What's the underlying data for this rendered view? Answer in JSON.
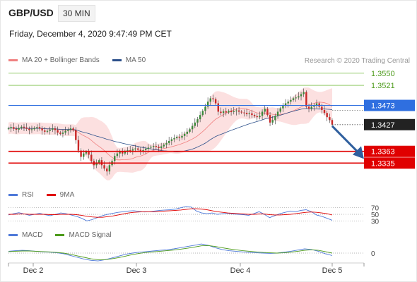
{
  "header": {
    "pair": "GBP/USD",
    "timeframe": "30 MIN",
    "datetime": "Friday, December 4, 2020 9:47:49 PM CET"
  },
  "legends": {
    "main": [
      {
        "label": "MA 20 + Bollinger Bands",
        "color": "#f08080"
      },
      {
        "label": "MA 50",
        "color": "#2b4f8a"
      }
    ],
    "rsi": [
      {
        "label": "RSI",
        "color": "#4e79d9"
      },
      {
        "label": "9MA",
        "color": "#e00000"
      }
    ],
    "macd": [
      {
        "label": "MACD",
        "color": "#4e79d9"
      },
      {
        "label": "MACD Signal",
        "color": "#4c9a1a"
      }
    ]
  },
  "credit": "Research © 2020 Trading Central",
  "chart_data": {
    "type": "candlestick",
    "instrument": "GBP/USD",
    "interval": "30 MIN",
    "x_ticks": [
      "Dec 2",
      "Dec 3",
      "Dec 4",
      "Dec 5"
    ],
    "ylim": [
      1.329,
      1.3565
    ],
    "current_price": 1.3427,
    "levels": [
      {
        "value": 1.355,
        "label": "1.3550",
        "kind": "resistance",
        "color": "#7cbf4a"
      },
      {
        "value": 1.3521,
        "label": "1.3521",
        "kind": "resistance",
        "color": "#7cbf4a"
      },
      {
        "value": 1.3473,
        "label": "1.3473",
        "kind": "pivot",
        "color": "#2f6fe0"
      },
      {
        "value": 1.3427,
        "label": "1.3427",
        "kind": "last",
        "color": "#222222"
      },
      {
        "value": 1.3363,
        "label": "1.3363",
        "kind": "support",
        "color": "#e00000"
      },
      {
        "value": 1.3335,
        "label": "1.3335",
        "kind": "support",
        "color": "#e00000"
      }
    ],
    "forecast_arrow": {
      "from": 1.3427,
      "to": 1.3335,
      "direction": "down"
    },
    "close_path": [
      1.3418,
      1.3421,
      1.3417,
      1.3415,
      1.3419,
      1.3422,
      1.342,
      1.3417,
      1.3414,
      1.3416,
      1.3419,
      1.3421,
      1.3418,
      1.3413,
      1.341,
      1.3412,
      1.3415,
      1.3418,
      1.3414,
      1.3408,
      1.3405,
      1.3408,
      1.3412,
      1.3415,
      1.3418,
      1.3414,
      1.339,
      1.3365,
      1.335,
      1.3358,
      1.3362,
      1.3355,
      1.334,
      1.333,
      1.3335,
      1.3342,
      1.333,
      1.3322,
      1.3315,
      1.333,
      1.334,
      1.3352,
      1.3358,
      1.3362,
      1.3358,
      1.3363,
      1.3366,
      1.3365,
      1.3368,
      1.337,
      1.3367,
      1.3363,
      1.3366,
      1.3369,
      1.3372,
      1.3374,
      1.3376,
      1.3374,
      1.3371,
      1.3375,
      1.3379,
      1.3383,
      1.3388,
      1.3392,
      1.3395,
      1.3398,
      1.3396,
      1.34,
      1.3405,
      1.341,
      1.3416,
      1.3424,
      1.3432,
      1.344,
      1.345,
      1.346,
      1.347,
      1.3482,
      1.349,
      1.3488,
      1.3478,
      1.3458,
      1.3455,
      1.3459,
      1.3456,
      1.346,
      1.3457,
      1.3459,
      1.3461,
      1.3458,
      1.3456,
      1.3455,
      1.3452,
      1.3454,
      1.345,
      1.3447,
      1.3445,
      1.3448,
      1.3458,
      1.3465,
      1.345,
      1.3432,
      1.3438,
      1.3448,
      1.3458,
      1.3466,
      1.3472,
      1.3478,
      1.3482,
      1.3486,
      1.349,
      1.3492,
      1.3495,
      1.35,
      1.3505,
      1.347,
      1.3465,
      1.347,
      1.3473,
      1.3478,
      1.347,
      1.3462,
      1.3455,
      1.3445,
      1.3438,
      1.3427
    ],
    "rsi": {
      "levels": [
        70,
        50,
        30
      ],
      "rsi": [
        48,
        52,
        55,
        51,
        47,
        50,
        53,
        49,
        46,
        50,
        54,
        52,
        48,
        44,
        38,
        30,
        34,
        40,
        46,
        50,
        53,
        56,
        58,
        60,
        61,
        59,
        57,
        58,
        60,
        62,
        63,
        64,
        66,
        70,
        74,
        72,
        60,
        54,
        52,
        54,
        50,
        52,
        53,
        51,
        50,
        49,
        47,
        52,
        58,
        50,
        40,
        46,
        52,
        56,
        60,
        58,
        62,
        64,
        58,
        48,
        44,
        38,
        32
      ],
      "ma9": [
        50,
        50,
        51,
        51,
        50,
        50,
        50,
        50,
        49,
        49,
        50,
        50,
        50,
        49,
        47,
        44,
        42,
        41,
        41,
        43,
        45,
        48,
        51,
        54,
        56,
        57,
        58,
        58,
        58,
        59,
        60,
        61,
        62,
        63,
        65,
        67,
        67,
        66,
        64,
        61,
        58,
        56,
        54,
        53,
        52,
        51,
        50,
        50,
        51,
        51,
        49,
        48,
        48,
        49,
        50,
        52,
        54,
        56,
        57,
        56,
        54,
        52,
        48
      ]
    },
    "macd": {
      "zero_line": 0,
      "macd": [
        0.0006,
        0.0008,
        0.0009,
        0.0008,
        0.0006,
        0.0004,
        0.0003,
        0.0001,
        -0.0002,
        -0.0008,
        -0.0014,
        -0.002,
        -0.0024,
        -0.0026,
        -0.0022,
        -0.0016,
        -0.001,
        -0.0004,
        0.0,
        0.0003,
        0.0005,
        0.0007,
        0.0009,
        0.0011,
        0.0014,
        0.0018,
        0.0022,
        0.0026,
        0.003,
        0.0026,
        0.0018,
        0.0012,
        0.0008,
        0.0006,
        0.0004,
        0.0002,
        0.0001,
        0.0,
        -0.0001,
        0.0,
        0.0003,
        0.0006,
        0.001,
        0.0014,
        0.0012,
        0.0006,
        -0.0002,
        -0.0008
      ],
      "signal": [
        0.0005,
        0.0006,
        0.0007,
        0.0007,
        0.0006,
        0.0005,
        0.0004,
        0.0002,
        0.0,
        -0.0004,
        -0.0009,
        -0.0014,
        -0.0019,
        -0.0022,
        -0.0022,
        -0.0019,
        -0.0015,
        -0.001,
        -0.0005,
        -0.0001,
        0.0002,
        0.0004,
        0.0006,
        0.0008,
        0.001,
        0.0013,
        0.0016,
        0.002,
        0.0024,
        0.0025,
        0.0022,
        0.0018,
        0.0014,
        0.0011,
        0.0008,
        0.0006,
        0.0004,
        0.0002,
        0.0001,
        0.0,
        0.0001,
        0.0003,
        0.0006,
        0.0009,
        0.0011,
        0.0009,
        0.0005,
        0.0
      ]
    }
  }
}
